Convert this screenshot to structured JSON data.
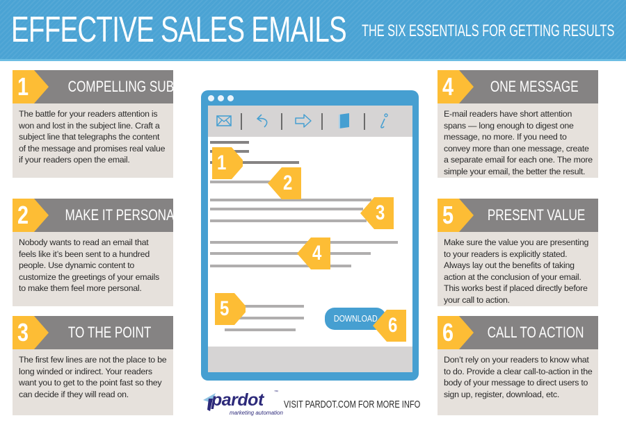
{
  "header": {
    "title": "EFFECTIVE SALES EMAILS",
    "subtitle": "THE SIX ESSENTIALS FOR GETTING RESULTS"
  },
  "colors": {
    "banner_blue": "#4aa3d4",
    "accent_yellow": "#fdbd35",
    "header_gray": "#858383",
    "body_beige": "#e6e1dc",
    "email_frame_blue": "#469fd1",
    "logo_navy": "#2d2a7a"
  },
  "essentials": [
    {
      "number": "1",
      "title": "COMPELLING SUBJECT",
      "body": "The battle for your readers attention is won and lost in the subject line. Craft a subject line that telegraphs the content of the message and promises real value if your readers open the email."
    },
    {
      "number": "2",
      "title": "MAKE IT PERSONAL",
      "body": "Nobody wants to read an email that feels like it’s been sent to a hundred people. Use dynamic content to customize the greetings of your emails to make them feel more personal."
    },
    {
      "number": "3",
      "title": "TO THE POINT",
      "body": "The first few lines are not the place to be long winded or indirect. Your readers want you to get to the point fast so they can decide if they will read on."
    },
    {
      "number": "4",
      "title": "ONE MESSAGE",
      "body": "E-mail readers have short attention spans — long enough to digest one message, no more. If you need to convey more than one message, create a separate email for each one. The more simple your email, the better the result."
    },
    {
      "number": "5",
      "title": "PRESENT VALUE",
      "body": "Make sure the value you are presenting to your readers is explicitly stated. Always lay out the benefits of taking action at the conclusion of your email. This works best if placed directly before your call to action."
    },
    {
      "number": "6",
      "title": "CALL TO ACTION",
      "body": "Don’t rely on your readers to know what to do. Provide a clear call-to-action in the body of your message to direct users to sign up, register, download, etc."
    }
  ],
  "email_mockup": {
    "toolbar_icons": [
      "envelope-icon",
      "reply-icon",
      "forward-arrow-icon",
      "book-icon",
      "info-icon"
    ],
    "markers": [
      "1",
      "2",
      "3",
      "4",
      "5",
      "6"
    ],
    "download_label": "DOWNLOAD"
  },
  "footer": {
    "logo_word": "pardot",
    "logo_trademark": "™",
    "logo_tagline": "marketing automation",
    "visit_text": "VISIT PARDOT.COM FOR MORE INFO"
  }
}
